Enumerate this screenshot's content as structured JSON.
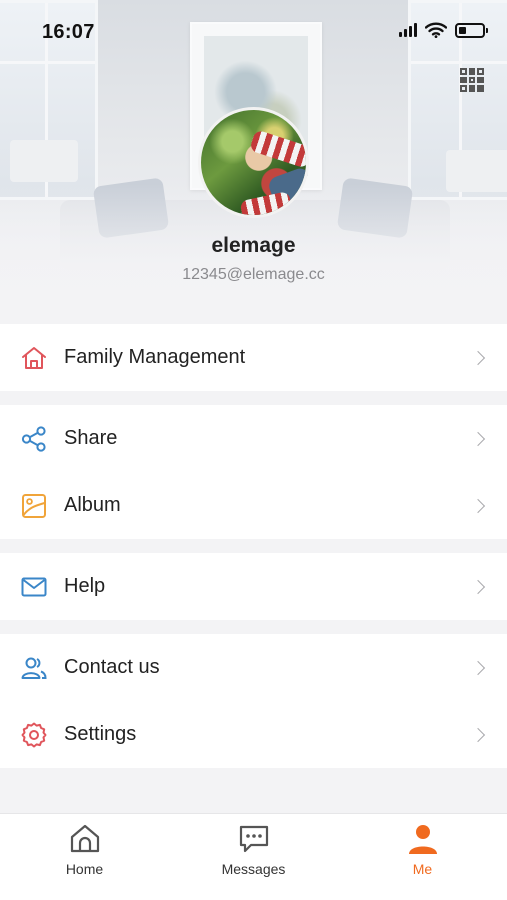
{
  "status_bar": {
    "time": "16:07"
  },
  "profile": {
    "username": "elemage",
    "email": "12345@elemage.cc"
  },
  "menu": {
    "groups": [
      [
        {
          "label": "Family Management",
          "icon": "home-icon"
        }
      ],
      [
        {
          "label": "Share",
          "icon": "share-icon"
        },
        {
          "label": "Album",
          "icon": "album-icon"
        }
      ],
      [
        {
          "label": "Help",
          "icon": "mail-icon"
        }
      ],
      [
        {
          "label": "Contact us",
          "icon": "contacts-icon"
        },
        {
          "label": "Settings",
          "icon": "gear-icon"
        }
      ]
    ]
  },
  "tabbar": {
    "home": "Home",
    "messages": "Messages",
    "me": "Me",
    "active": "me"
  },
  "colors": {
    "accent": "#f06a1f",
    "home_icon": "#e0555b",
    "share_icon": "#3a86c8",
    "album_icon": "#f0a43a",
    "help_icon": "#3a86c8",
    "contact_icon": "#3a86c8",
    "settings_icon": "#e0555b"
  }
}
